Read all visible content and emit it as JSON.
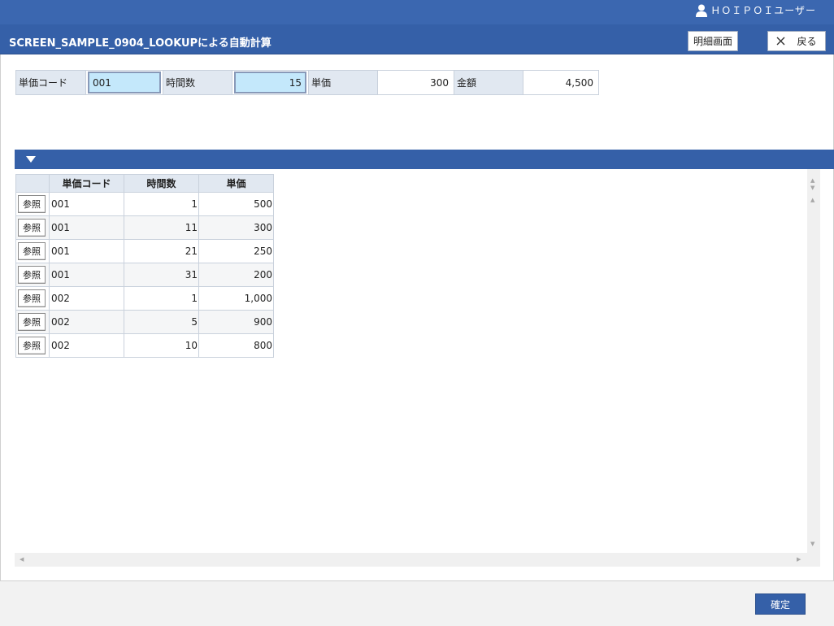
{
  "header": {
    "user_name": "ＨＯＩＰＯＩユーザー",
    "title": "SCREEN_SAMPLE_0904_LOOKUPによる自動計算",
    "detail_button": "明細画面",
    "back_button": "戻る"
  },
  "form": {
    "unit_code_label": "単価コード",
    "unit_code_value": "001",
    "hours_label": "時間数",
    "hours_value": "15",
    "unit_price_label": "単価",
    "unit_price_value": "300",
    "amount_label": "金額",
    "amount_value": "4,500"
  },
  "grid": {
    "columns": [
      "",
      "単価コード",
      "時間数",
      "単価"
    ],
    "ref_label": "参照",
    "rows": [
      {
        "code": "001",
        "hours": "1",
        "price": "500"
      },
      {
        "code": "001",
        "hours": "11",
        "price": "300"
      },
      {
        "code": "001",
        "hours": "21",
        "price": "250"
      },
      {
        "code": "001",
        "hours": "31",
        "price": "200"
      },
      {
        "code": "002",
        "hours": "1",
        "price": "1,000"
      },
      {
        "code": "002",
        "hours": "5",
        "price": "900"
      },
      {
        "code": "002",
        "hours": "10",
        "price": "800"
      }
    ]
  },
  "footer": {
    "confirm_button": "確定"
  },
  "colors": {
    "primary": "#3560a8",
    "label_bg": "#e1e8f1",
    "input_highlight": "#c4e8fb"
  }
}
